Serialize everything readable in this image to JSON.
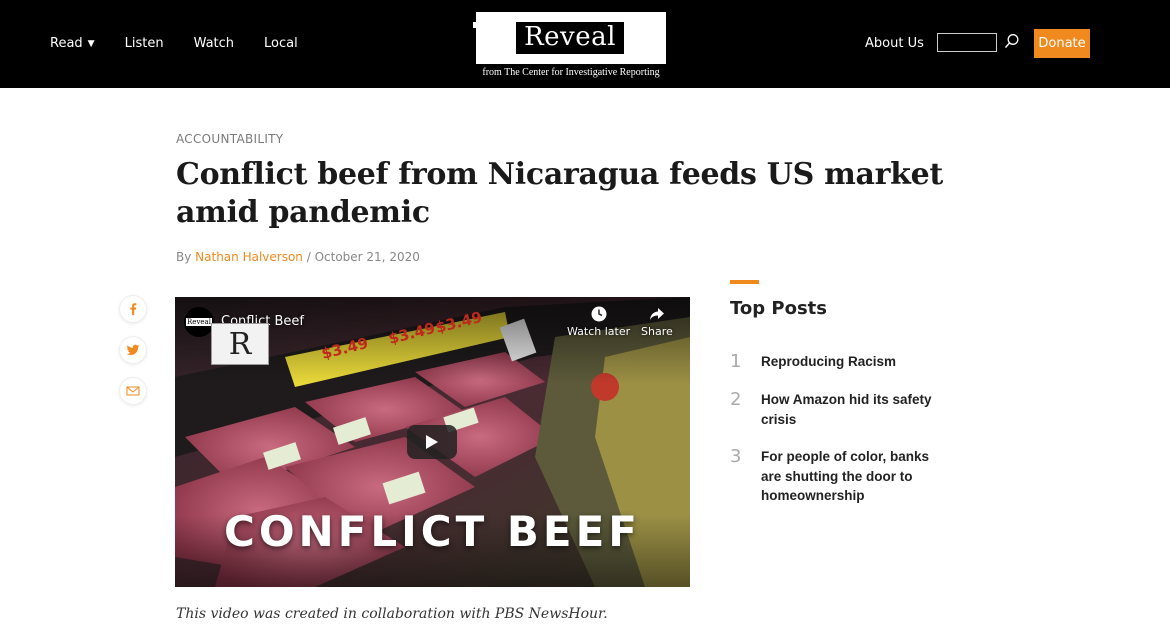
{
  "header": {
    "nav_left": [
      {
        "label": "Read",
        "has_caret": true,
        "caret": "▼"
      },
      {
        "label": "Listen"
      },
      {
        "label": "Watch"
      },
      {
        "label": "Local"
      }
    ],
    "logo_word": "Reveal",
    "logo_subtitle": "from The Center for Investigative Reporting",
    "about_label": "About Us",
    "search_icon": "search-icon",
    "donate_label": "Donate",
    "accent_color": "#f0891e"
  },
  "article": {
    "category": "ACCOUNTABILITY",
    "title": "Conflict beef from Nicaragua feeds US market amid pandemic",
    "byline_prefix": "By ",
    "author": "Nathan Halverson",
    "date_sep": " / ",
    "date": "October 21, 2020",
    "share_icons": [
      "facebook-icon",
      "twitter-icon",
      "email-icon"
    ],
    "video": {
      "channel_logo_text": "Reveal",
      "title": "Conflict Beef",
      "thumb_letter": "R",
      "watch_later_label": "Watch later",
      "share_label": "Share",
      "overlay_text": "CONFLICT BEEF",
      "price_tags": [
        "$3.49",
        "$3.49",
        "$3.49"
      ]
    },
    "video_note": "This video was created in collaboration with PBS NewsHour."
  },
  "sidebar": {
    "title": "Top Posts",
    "posts": [
      {
        "num": "1",
        "title": "Reproducing Racism"
      },
      {
        "num": "2",
        "title": "How Amazon hid its safety crisis"
      },
      {
        "num": "3",
        "title": "For people of color, banks are shutting the door to homeownership"
      }
    ]
  }
}
